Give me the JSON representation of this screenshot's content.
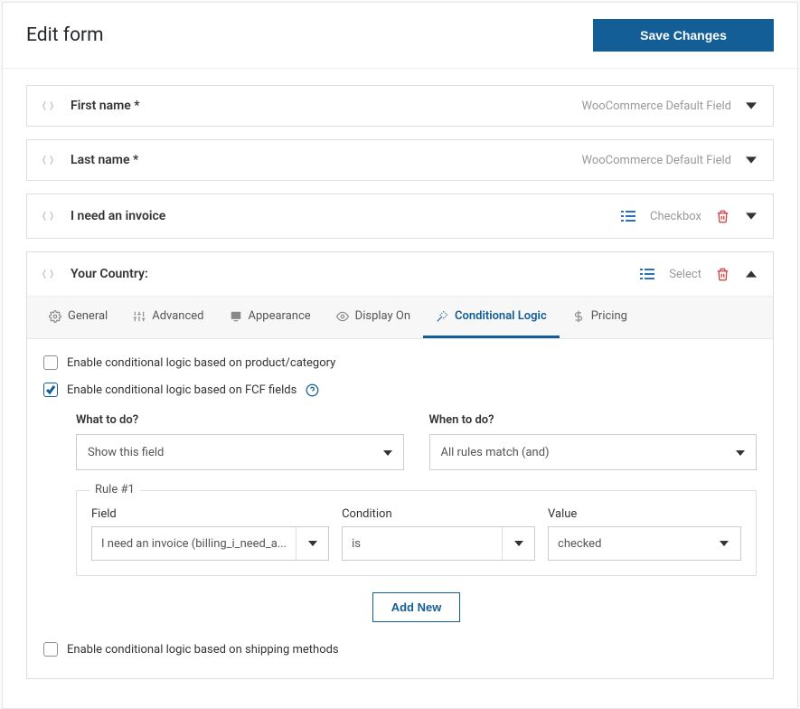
{
  "header": {
    "title": "Edit form",
    "save_btn": "Save Changes"
  },
  "fields": [
    {
      "label": "First name *",
      "type": "WooCommerce Default Field",
      "has_list_icon": false,
      "has_trash": false,
      "expanded": false
    },
    {
      "label": "Last name *",
      "type": "WooCommerce Default Field",
      "has_list_icon": false,
      "has_trash": false,
      "expanded": false
    },
    {
      "label": "I need an invoice",
      "type": "Checkbox",
      "has_list_icon": true,
      "has_trash": true,
      "expanded": false
    },
    {
      "label": "Your Country:",
      "type": "Select",
      "has_list_icon": true,
      "has_trash": true,
      "expanded": true
    }
  ],
  "tabs": [
    {
      "icon": "gear",
      "label": "General"
    },
    {
      "icon": "sliders",
      "label": "Advanced"
    },
    {
      "icon": "appearance",
      "label": "Appearance"
    },
    {
      "icon": "eye",
      "label": "Display On"
    },
    {
      "icon": "wand",
      "label": "Conditional Logic",
      "active": true
    },
    {
      "icon": "dollar",
      "label": "Pricing"
    }
  ],
  "panel": {
    "chk1_label": "Enable conditional logic based on product/category",
    "chk2_label": "Enable conditional logic based on FCF fields",
    "chk3_label": "Enable conditional logic based on shipping methods",
    "what_label": "What to do?",
    "what_value": "Show this field",
    "when_label": "When to do?",
    "when_value": "All rules match (and)",
    "rule_title": "Rule #1",
    "field_label": "Field",
    "field_value": "I need an invoice (billing_i_need_a...",
    "cond_label": "Condition",
    "cond_value": "is",
    "value_label": "Value",
    "value_value": "checked",
    "add_new": "Add New"
  }
}
